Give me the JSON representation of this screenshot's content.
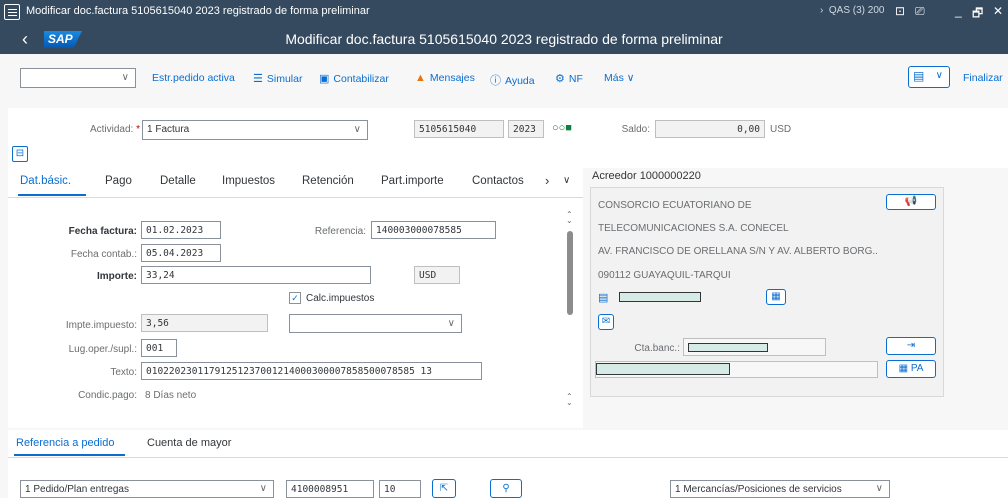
{
  "window": {
    "title": "Modificar doc.factura 5105615040 2023 registrado de forma preliminar",
    "system": "QAS (3) 200",
    "controls": [
      "⊡",
      "⎚",
      "_",
      "🗗",
      "✕"
    ]
  },
  "shell": {
    "logo": "SAP",
    "page_title": "Modificar doc.factura 5105615040 2023 registrado de forma preliminar"
  },
  "toolbar": {
    "estr_pedido": "Estr.pedido activa",
    "simular": "Simular",
    "contabilizar": "Contabilizar",
    "mensajes": "Mensajes",
    "ayuda": "Ayuda",
    "nf": "NF",
    "mas": "Más",
    "finalizar": "Finalizar"
  },
  "header": {
    "actividad_label": "Actividad:",
    "actividad_value": "1 Factura",
    "doc_number": "5105615040",
    "year": "2023",
    "saldo_label": "Saldo:",
    "saldo_value": "0,00",
    "saldo_currency": "USD"
  },
  "tabs": [
    "Dat.básic.",
    "Pago",
    "Detalle",
    "Impuestos",
    "Retención",
    "Part.importe",
    "Contactos"
  ],
  "form": {
    "fecha_factura_label": "Fecha factura:",
    "fecha_factura": "01.02.2023",
    "referencia_label": "Referencia:",
    "referencia": "140003000078585",
    "fecha_contab_label": "Fecha contab.:",
    "fecha_contab": "05.04.2023",
    "importe_label": "Importe:",
    "importe": "33,24",
    "moneda": "USD",
    "calc_impuestos": "Calc.impuestos",
    "calc_impuestos_checked": true,
    "impte_impuesto_label": "Impte.impuesto:",
    "impte_impuesto": "3,56",
    "lug_oper_label": "Lug.oper./supl.:",
    "lug_oper": "001",
    "texto_label": "Texto:",
    "texto": "01022023011791251237001214000300007858500078585 13",
    "condic_pago_label": "Condic.pago:",
    "condic_pago": "8 Días neto"
  },
  "vendor": {
    "title": "Acreedor 1000000220",
    "lines": [
      "CONSORCIO ECUATORIANO DE",
      "TELECOMUNICACIONES S.A. CONECEL",
      "AV. FRANCISCO DE ORELLANA S/N Y AV. ALBERTO BORG..",
      "090112 GUAYAQUIL-TARQUI"
    ],
    "cta_banc_label": "Cta.banc.:",
    "pa_label": "PA"
  },
  "bottom_tabs": [
    "Referencia a pedido",
    "Cuenta de mayor"
  ],
  "po_row": {
    "type": "1 Pedido/Plan entregas",
    "po_number": "4100008951",
    "item": "10",
    "mercancias": "1 Mercancías/Posiciones de servicios"
  },
  "colors": {
    "shell": "#354a5f",
    "accent": "#0a6ed1",
    "warning": "#e9730c"
  }
}
